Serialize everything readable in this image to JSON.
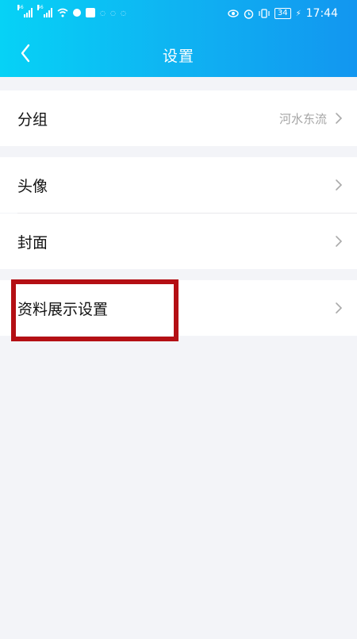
{
  "status_bar": {
    "time": "17:44",
    "battery": "34",
    "network_tags": [
      "46",
      "46"
    ]
  },
  "header": {
    "title": "设置",
    "back_icon": "chevron-left-icon"
  },
  "rows": {
    "group": {
      "label": "分组",
      "value": "河水东流"
    },
    "avatar": {
      "label": "头像"
    },
    "cover": {
      "label": "封面"
    },
    "profile_display": {
      "label": "资料展示设置"
    }
  },
  "colors": {
    "header_start": "#06d2f6",
    "header_end": "#1296f0",
    "page_bg": "#f3f4f8",
    "highlight_box": "#b40f14"
  }
}
